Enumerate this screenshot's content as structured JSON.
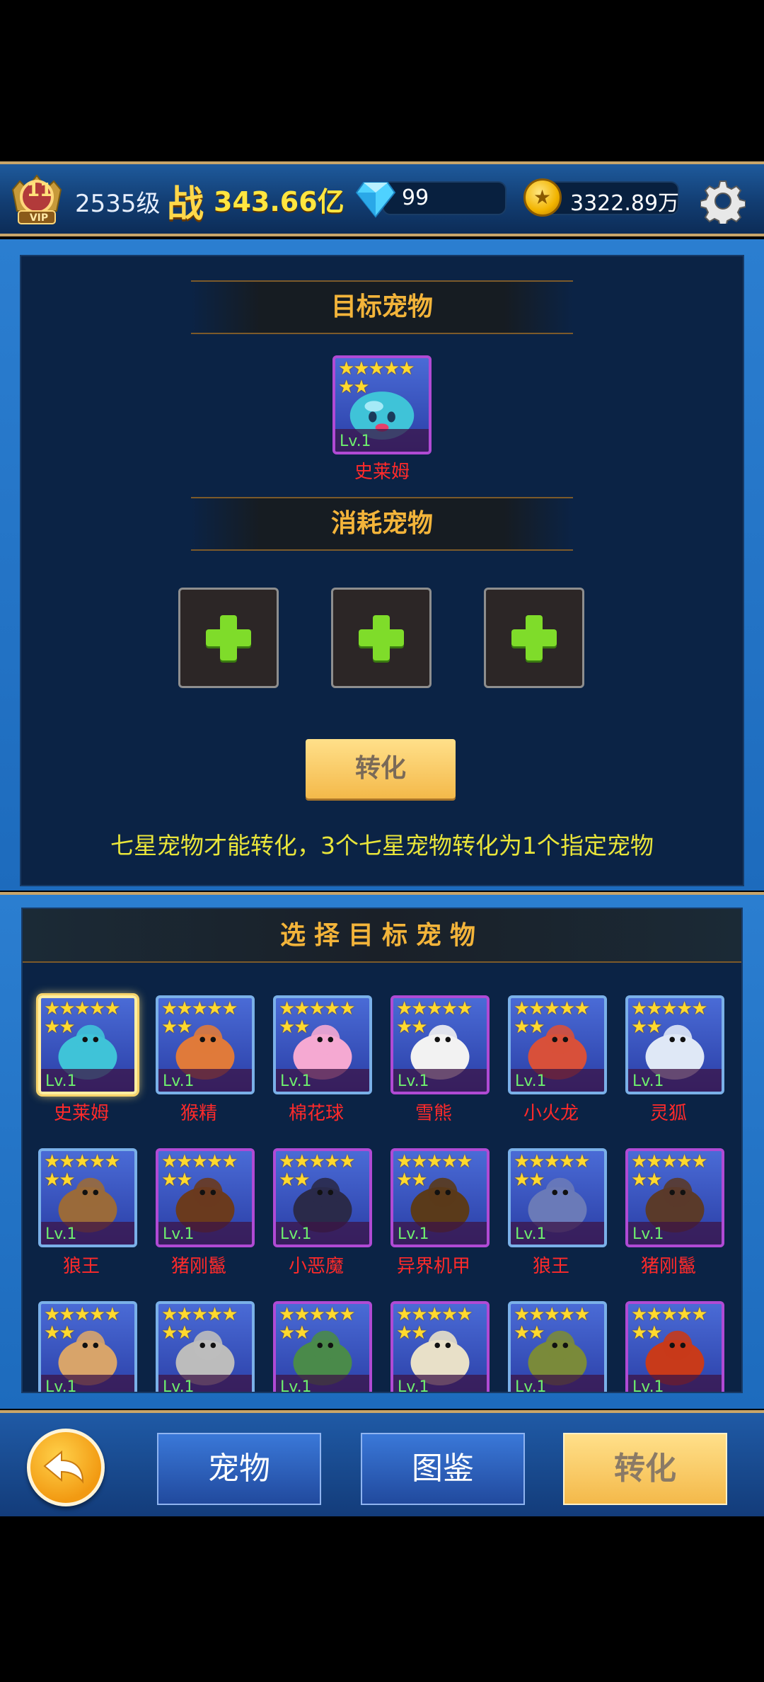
{
  "header": {
    "vip_level": "11",
    "vip_label": "VIP",
    "player_level": "2535级",
    "power_icon": "战",
    "power": "343.66亿",
    "gems": "99",
    "coins": "3322.89万",
    "icons": [
      "vip-badge-icon",
      "diamond-icon",
      "coin-icon",
      "gear-icon"
    ]
  },
  "target": {
    "section_title": "目标宠物",
    "pet": {
      "name": "史莱姆",
      "level": "Lv.1",
      "stars": 7
    }
  },
  "consume": {
    "section_title": "消耗宠物",
    "slots": 3
  },
  "convert_button": "转化",
  "hint": "七星宠物才能转化，3个七星宠物转化为1个指定宠物",
  "selection": {
    "title": "选择目标宠物",
    "pets": [
      {
        "name": "史莱姆",
        "level": "Lv.1",
        "art": "slime",
        "color": "#3fc3d8",
        "frame": "gold",
        "selected": true
      },
      {
        "name": "猴精",
        "level": "Lv.1",
        "art": "monkey",
        "color": "#e07a3a",
        "frame": "blue"
      },
      {
        "name": "棉花球",
        "level": "Lv.1",
        "art": "cotton",
        "color": "#f5a9d2",
        "frame": "blue"
      },
      {
        "name": "雪熊",
        "level": "Lv.1",
        "art": "snowbear",
        "color": "#f2f2f2",
        "frame": "purple"
      },
      {
        "name": "小火龙",
        "level": "Lv.1",
        "art": "dragon",
        "color": "#d8503a",
        "frame": "blue"
      },
      {
        "name": "灵狐",
        "level": "Lv.1",
        "art": "fox",
        "color": "#dfe8f6",
        "frame": "blue"
      },
      {
        "name": "狼王",
        "level": "Lv.1",
        "art": "wolf",
        "color": "#9a6a3a",
        "frame": "blue"
      },
      {
        "name": "猪刚鬣",
        "level": "Lv.1",
        "art": "boar",
        "color": "#6a3a1e",
        "frame": "purple"
      },
      {
        "name": "小恶魔",
        "level": "Lv.1",
        "art": "imp",
        "color": "#2a2a4a",
        "frame": "purple"
      },
      {
        "name": "异界机甲",
        "level": "Lv.1",
        "art": "mech",
        "color": "#5a3a1a",
        "frame": "purple"
      },
      {
        "name": "狼王",
        "level": "Lv.1",
        "art": "wolf2",
        "color": "#6a7ab8",
        "frame": "blue"
      },
      {
        "name": "猪刚鬣",
        "level": "Lv.1",
        "art": "boar2",
        "color": "#5a3a2a",
        "frame": "purple"
      },
      {
        "name": "",
        "level": "Lv.1",
        "art": "bull",
        "color": "#d8a46a",
        "frame": "blue"
      },
      {
        "name": "",
        "level": "Lv.1",
        "art": "golem",
        "color": "#bcbcbc",
        "frame": "blue"
      },
      {
        "name": "",
        "level": "Lv.1",
        "art": "goblin",
        "color": "#4a8a4a",
        "frame": "purple"
      },
      {
        "name": "",
        "level": "Lv.1",
        "art": "skeleton",
        "color": "#e8e0c8",
        "frame": "purple"
      },
      {
        "name": "",
        "level": "Lv.1",
        "art": "treant",
        "color": "#7a8a3a",
        "frame": "blue"
      },
      {
        "name": "",
        "level": "Lv.1",
        "art": "lavaturtle",
        "color": "#c83a1a",
        "frame": "purple"
      }
    ]
  },
  "bottom_nav": {
    "back_icon": "back-arrow-icon",
    "tabs": [
      {
        "label": "宠物",
        "active": false
      },
      {
        "label": "图鉴",
        "active": false
      },
      {
        "label": "转化",
        "active": true
      }
    ]
  }
}
